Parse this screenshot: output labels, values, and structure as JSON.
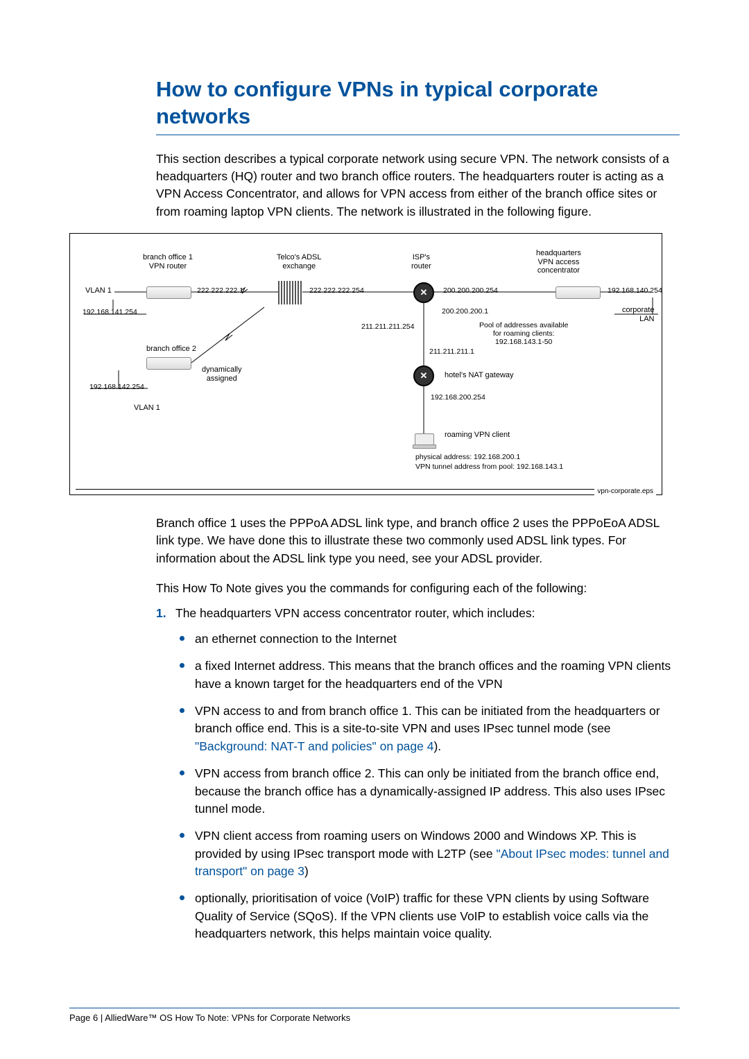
{
  "title": "How to configure VPNs in typical corporate networks",
  "intro": "This section describes a typical corporate network using secure VPN. The network consists of a headquarters (HQ) router and two branch office routers. The headquarters router is acting as a VPN Access Concentrator, and allows for VPN access from either of the branch office sites or from roaming laptop VPN clients. The network is illustrated in the following figure.",
  "diagram": {
    "branch1_label": "branch office 1\nVPN router",
    "telco_label": "Telco's ADSL\nexchange",
    "isp_label": "ISP's\nrouter",
    "hq_label": "headquarters\nVPN access\nconcentrator",
    "vlan1_top": "VLAN 1",
    "ip_branch1_right": "222.222.222.1",
    "ip_telco_right": "222.222.222.254",
    "ip_isp_right": "200.200.200.254",
    "ip_hq_right": "192.168.140.254",
    "ip_branch1_lan": "192.168.141.254",
    "ip_isp_down2": "200.200.200.1",
    "ip_isp_down1": "211.211.211.254",
    "corp_lan": "corporate\nLAN",
    "pool": "Pool of addresses available\nfor roaming clients:\n192.168.143.1-50",
    "branch2_label": "branch office 2",
    "ip_hotel_up": "211.211.211.1",
    "dyn_label": "dynamically\nassigned",
    "hotel_label": "hotel's NAT gateway",
    "ip_branch2_lan": "192.168.142.254",
    "ip_hotel_down": "192.168.200.254",
    "vlan1_bot": "VLAN 1",
    "roaming_label": "roaming VPN client",
    "roaming_phys": "physical address: 192.168.200.1",
    "roaming_tun": "VPN tunnel address from pool: 192.168.143.1",
    "eps": "vpn-corporate.eps"
  },
  "after_diagram": "Branch office 1 uses the PPPoA ADSL link type, and branch office 2 uses the PPPoEoA ADSL link type. We have done this to illustrate these two commonly used ADSL link types. For information about the ADSL link type you need, see your ADSL provider.",
  "list_intro": "This How To Note gives you the commands for configuring each of the following:",
  "list": {
    "num": "1",
    "lead": "The headquarters VPN access concentrator router, which includes:",
    "items": {
      "a": "an ethernet connection to the Internet",
      "b": "a fixed Internet address. This means that the branch offices and the roaming VPN clients have a known target for the headquarters end of the VPN",
      "c_pre": "VPN access to and from branch office 1. This can be initiated from the headquarters or branch office end. This is a site-to-site VPN and uses IPsec tunnel mode (see ",
      "c_link": "\"Background: NAT-T and policies\" on page 4",
      "c_post": ").",
      "d": "VPN access from branch office 2. This can only be initiated from the branch office end, because the branch office has a dynamically-assigned IP address. This also uses IPsec tunnel mode.",
      "e_pre": "VPN client access from roaming users on Windows 2000 and Windows XP. This is provided by using IPsec transport mode with L2TP (see ",
      "e_link": "\"About IPsec modes: tunnel and transport\" on page 3",
      "e_post": ")",
      "f": "optionally, prioritisation of voice (VoIP) traffic for these VPN clients by using Software Quality of Service (SQoS). If the VPN clients use VoIP to establish voice calls via the headquarters network, this helps maintain voice quality."
    }
  },
  "footer": "Page 6 | AlliedWare™ OS How To Note: VPNs for Corporate Networks"
}
